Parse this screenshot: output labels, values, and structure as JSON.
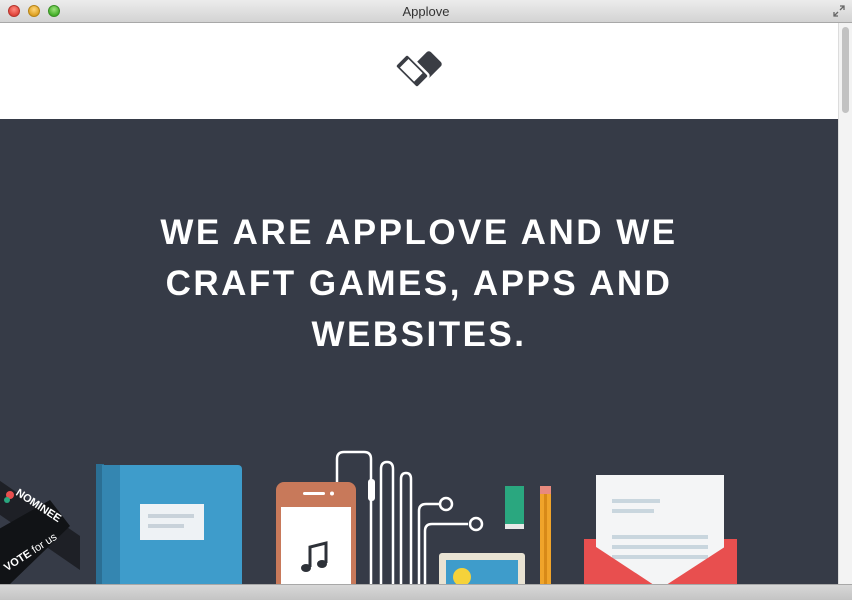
{
  "window": {
    "title": "Applove"
  },
  "header": {
    "logo_icon": "applove-devices-logo-icon"
  },
  "hero": {
    "headline_lines": [
      "WE ARE APPLOVE AND WE",
      "CRAFT GAMES, APPS AND",
      "WEBSITES."
    ],
    "background": "#363b47"
  },
  "ribbon": {
    "nominee": "NOMINEE",
    "vote_word": "VOTE",
    "vote_for": "for us"
  },
  "illustration": {
    "items": [
      "book-icon",
      "phone-music-icon",
      "earphones-icon",
      "eraser-icon",
      "pencil-icon",
      "photo-frame-icon",
      "envelope-icon"
    ],
    "colors": {
      "book": "#3e9ccb",
      "phone": "#c8795a",
      "envelope": "#e84f4f",
      "eraser": "#2aa77f",
      "pencil": "#f0a42a"
    }
  }
}
